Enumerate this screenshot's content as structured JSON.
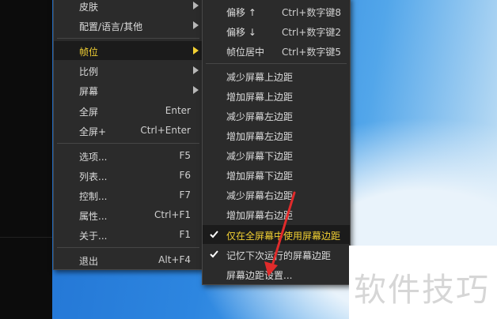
{
  "main_menu": {
    "items": [
      {
        "label": "皮肤",
        "shortcut": "",
        "submenu": true
      },
      {
        "label": "配置/语言/其他",
        "shortcut": "",
        "submenu": true
      },
      {
        "label": "帧位",
        "shortcut": "",
        "submenu": true,
        "active": true
      },
      {
        "label": "比例",
        "shortcut": "",
        "submenu": true
      },
      {
        "label": "屏幕",
        "shortcut": "",
        "submenu": true
      },
      {
        "label": "全屏",
        "shortcut": "Enter"
      },
      {
        "label": "全屏+",
        "shortcut": "Ctrl+Enter"
      },
      {
        "label": "选项...",
        "shortcut": "F5"
      },
      {
        "label": "列表...",
        "shortcut": "F6"
      },
      {
        "label": "控制...",
        "shortcut": "F7"
      },
      {
        "label": "属性...",
        "shortcut": "Ctrl+F1"
      },
      {
        "label": "关于...",
        "shortcut": "F1"
      },
      {
        "label": "退出",
        "shortcut": "Alt+F4"
      }
    ]
  },
  "sub_menu": {
    "items": [
      {
        "label": "偏移 ↑",
        "shortcut": "Ctrl+数字键8"
      },
      {
        "label": "偏移 ↓",
        "shortcut": "Ctrl+数字键2"
      },
      {
        "label": "帧位居中",
        "shortcut": "Ctrl+数字键5"
      },
      {
        "label": "减少屏幕上边距",
        "shortcut": ""
      },
      {
        "label": "增加屏幕上边距",
        "shortcut": ""
      },
      {
        "label": "减少屏幕左边距",
        "shortcut": ""
      },
      {
        "label": "增加屏幕左边距",
        "shortcut": ""
      },
      {
        "label": "减少屏幕下边距",
        "shortcut": ""
      },
      {
        "label": "增加屏幕下边距",
        "shortcut": ""
      },
      {
        "label": "减少屏幕右边距",
        "shortcut": ""
      },
      {
        "label": "增加屏幕右边距",
        "shortcut": ""
      },
      {
        "label": "仅在全屏幕中使用屏幕边距",
        "shortcut": "",
        "checked": true,
        "highlighted": true
      },
      {
        "label": "记忆下次运行的屏幕边距",
        "shortcut": "",
        "checked": true
      },
      {
        "label": "屏幕边距设置...",
        "shortcut": ""
      }
    ]
  },
  "watermark": {
    "text": "软件技巧"
  },
  "colors": {
    "menu_bg": "#2b2b2b",
    "highlight_text": "#f2d033",
    "annotation_arrow": "#e02b2b"
  },
  "icons": {
    "submenu_arrow": "triangle-right",
    "check": "checkmark"
  }
}
